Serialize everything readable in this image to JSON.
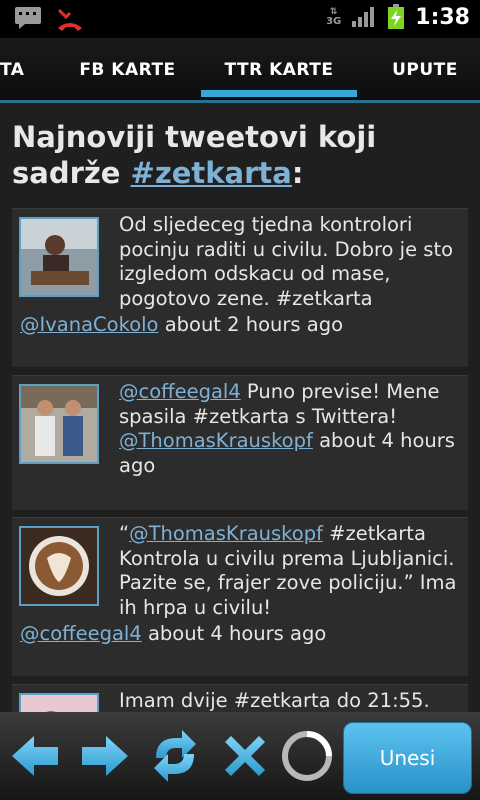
{
  "status_bar": {
    "time": "1:38",
    "network": "3G"
  },
  "tabs": [
    {
      "label": "TA"
    },
    {
      "label": "FB KARTE"
    },
    {
      "label": "TTR KARTE"
    },
    {
      "label": "UPUTE"
    }
  ],
  "heading": {
    "text": "Najnoviji tweetovi koji sadrže ",
    "hashtag": "#zetkarta",
    "suffix": ":"
  },
  "tweets": [
    {
      "text": "Od sljedeceg tjedna kontrolori pocinju raditi u civilu. Dobro je sto izgledom odskacu od mase, pogotovo zene. #zetkarta",
      "author": "@IvanaCokolo",
      "time": "about 2 hours ago"
    },
    {
      "mention": "@coffeegal4",
      "text": " Puno previse! Mene spasila #zetkarta s Twittera!",
      "author": "@ThomasKrauskopf",
      "time": "about 4 hours ago"
    },
    {
      "open_quote": "“",
      "mention": "@ThomasKrauskopf",
      "text": " #zetkarta Kontrola u civilu prema Ljubljanici. Pazite se, frajer zove policiju.” Ima ih hrpa u civilu!",
      "author": "@coffeegal4",
      "time": "about 4 hours ago"
    },
    {
      "text": "Imam dvije #zetkarta do 21:55."
    }
  ],
  "toolbar": {
    "submit_label": "Unesi"
  }
}
